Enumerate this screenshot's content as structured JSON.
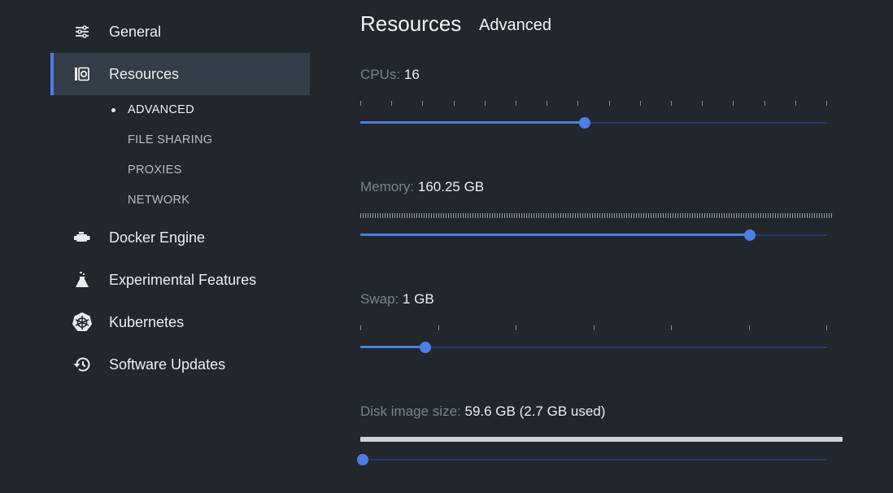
{
  "sidebar": {
    "items": [
      {
        "label": "General",
        "icon": "sliders-icon"
      },
      {
        "label": "Resources",
        "icon": "resources-icon",
        "active": true
      },
      {
        "label": "Docker Engine",
        "icon": "engine-icon"
      },
      {
        "label": "Experimental Features",
        "icon": "flask-icon"
      },
      {
        "label": "Kubernetes",
        "icon": "helm-wheel-icon"
      },
      {
        "label": "Software Updates",
        "icon": "history-icon"
      }
    ],
    "subitems": [
      {
        "label": "ADVANCED",
        "active": true
      },
      {
        "label": "FILE SHARING"
      },
      {
        "label": "PROXIES"
      },
      {
        "label": "NETWORK"
      }
    ]
  },
  "main": {
    "title": "Resources",
    "subtitle": "Advanced",
    "cpus": {
      "label": "CPUs:",
      "value": "16",
      "level": 0.48
    },
    "memory": {
      "label": "Memory:",
      "value": "160.25 GB",
      "level": 0.835
    },
    "swap": {
      "label": "Swap:",
      "value": "1 GB",
      "level": 0.14
    },
    "disk": {
      "label": "Disk image size:",
      "value": "59.6 GB (2.7 GB used)",
      "level": 0.0
    }
  },
  "colors": {
    "background": "#21272c",
    "accent": "#4c7de8",
    "active_nav_bg": "#333e48",
    "track": "#2a3a66"
  }
}
